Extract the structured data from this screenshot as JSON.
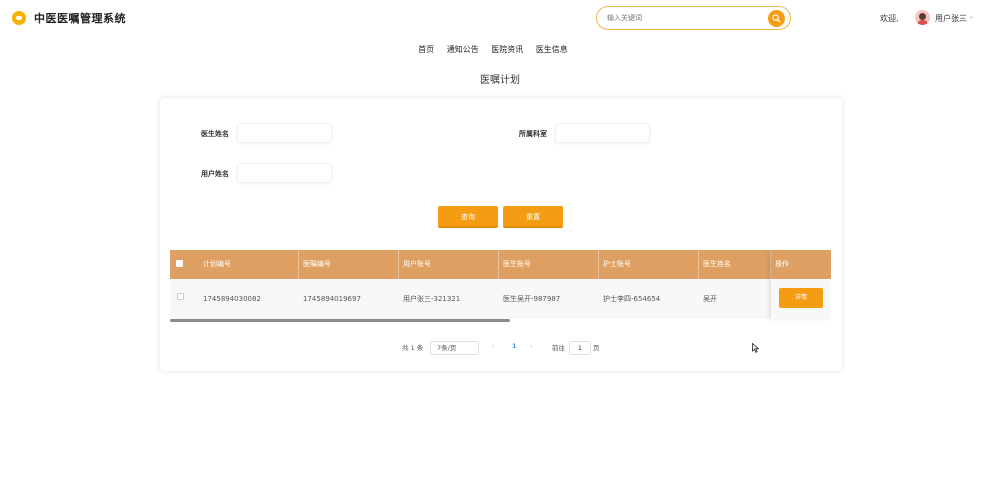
{
  "header": {
    "app_title": "中医医嘱管理系统",
    "search_placeholder": "输入关键词",
    "welcome": "欢迎,",
    "username": "用户张三",
    "caret": "⌄"
  },
  "nav": {
    "items": [
      {
        "label": "首页"
      },
      {
        "label": "通知公告"
      },
      {
        "label": "医院资讯"
      },
      {
        "label": "医生信息"
      }
    ]
  },
  "page": {
    "title": "医嘱计划"
  },
  "filters": {
    "doctor_name_label": "医生姓名",
    "department_label": "所属科室",
    "user_name_label": "用户姓名",
    "doctor_name_value": "",
    "department_value": "",
    "user_name_value": ""
  },
  "buttons": {
    "search": "查询",
    "reset": "重置"
  },
  "table": {
    "columns": [
      "计划编号",
      "医嘱编号",
      "用户账号",
      "医生账号",
      "护士账号",
      "医生姓名",
      "操作"
    ],
    "rows": [
      {
        "plan_no": "1745894030082",
        "order_no": "1745894019697",
        "user_account": "用户张三-321321",
        "doctor_account": "医生吴开-987987",
        "nurse_account": "护士李四-654654",
        "doctor_name": "吴开",
        "action": "详情"
      }
    ]
  },
  "pagination": {
    "total": "共 1 条",
    "page_size": "7条/页",
    "current_page": "1",
    "goto_label": "前往",
    "goto_value": "1",
    "page_suffix": "页",
    "prev": "‹",
    "next": "›"
  },
  "colors": {
    "accent": "#f59d12",
    "table_header": "#dea062"
  }
}
